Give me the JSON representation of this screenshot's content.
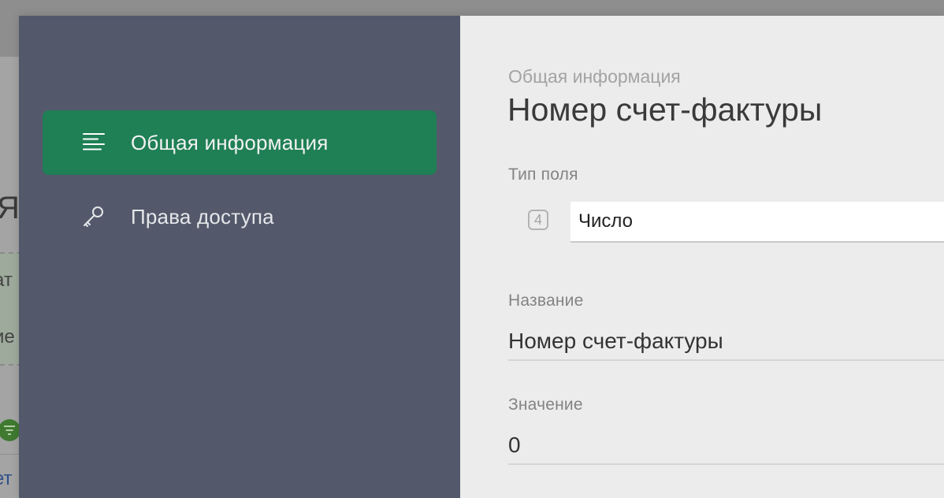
{
  "background": {
    "heading_fragment": "Я",
    "row1_fragment": "ат",
    "row2_fragment": "ие",
    "link_fragment": "ет"
  },
  "sidebar": {
    "items": [
      {
        "label": "Общая информация",
        "icon": "list-lines-icon",
        "active": true
      },
      {
        "label": "Права доступа",
        "icon": "key-icon",
        "active": false
      }
    ]
  },
  "content": {
    "section_caption": "Общая информация",
    "title": "Номер счет-фактуры",
    "field_type": {
      "label": "Тип поля",
      "badge": "4",
      "value": "Число"
    },
    "name_field": {
      "label": "Название",
      "value": "Номер счет-фактуры"
    },
    "value_field": {
      "label": "Значение",
      "value": "0"
    }
  },
  "colors": {
    "sidebar_bg": "#53596b",
    "active_item": "#1f7f55",
    "content_bg": "#ececec"
  }
}
